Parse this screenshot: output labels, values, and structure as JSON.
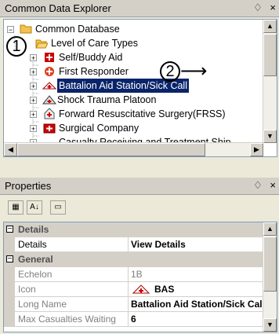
{
  "explorer": {
    "title": "Common Data Explorer",
    "pin": "♢",
    "close": "×",
    "tree": [
      {
        "label": "Common Database",
        "expander": "−",
        "icon": "folder"
      },
      {
        "label": "Level of Care Types",
        "icon": "folder-open"
      },
      {
        "label": "Self/Buddy Aid",
        "expander": "+",
        "icon": "self-buddy"
      },
      {
        "label": "First Responder",
        "expander": "+",
        "icon": "first-responder"
      },
      {
        "label": "Battalion Aid Station/Sick Call",
        "expander": "+",
        "icon": "bas",
        "selected": true
      },
      {
        "label": "Shock Trauma Platoon",
        "expander": "+",
        "icon": "stp"
      },
      {
        "label": "Forward Resuscitative Surgery(FRSS)",
        "expander": "+",
        "icon": "frss"
      },
      {
        "label": "Surgical Company",
        "expander": "+",
        "icon": "surgical"
      },
      {
        "label": "Casualty Receiving and Treatment Ship",
        "expander": "+",
        "icon": "ship"
      }
    ]
  },
  "callouts": {
    "one": "1",
    "two": "2",
    "arrow": "⟶"
  },
  "properties": {
    "title": "Properties",
    "pin": "♢",
    "close": "×",
    "toolbar": {
      "categorized": "▦",
      "alphabetical": "A↓",
      "pages": "▭"
    },
    "rows": [
      {
        "type": "category",
        "name": "Details"
      },
      {
        "type": "prop",
        "name": "Details",
        "value": "View Details"
      },
      {
        "type": "category",
        "name": "General"
      },
      {
        "type": "prop",
        "name": "Echelon",
        "value": "1B",
        "dim": true
      },
      {
        "type": "prop",
        "name": "Icon",
        "value": "BAS",
        "icon": true
      },
      {
        "type": "prop",
        "name": "Long Name",
        "value": "Battalion Aid Station/Sick Call"
      },
      {
        "type": "prop",
        "name": "Max Casualties Waiting",
        "value": "6"
      }
    ]
  }
}
